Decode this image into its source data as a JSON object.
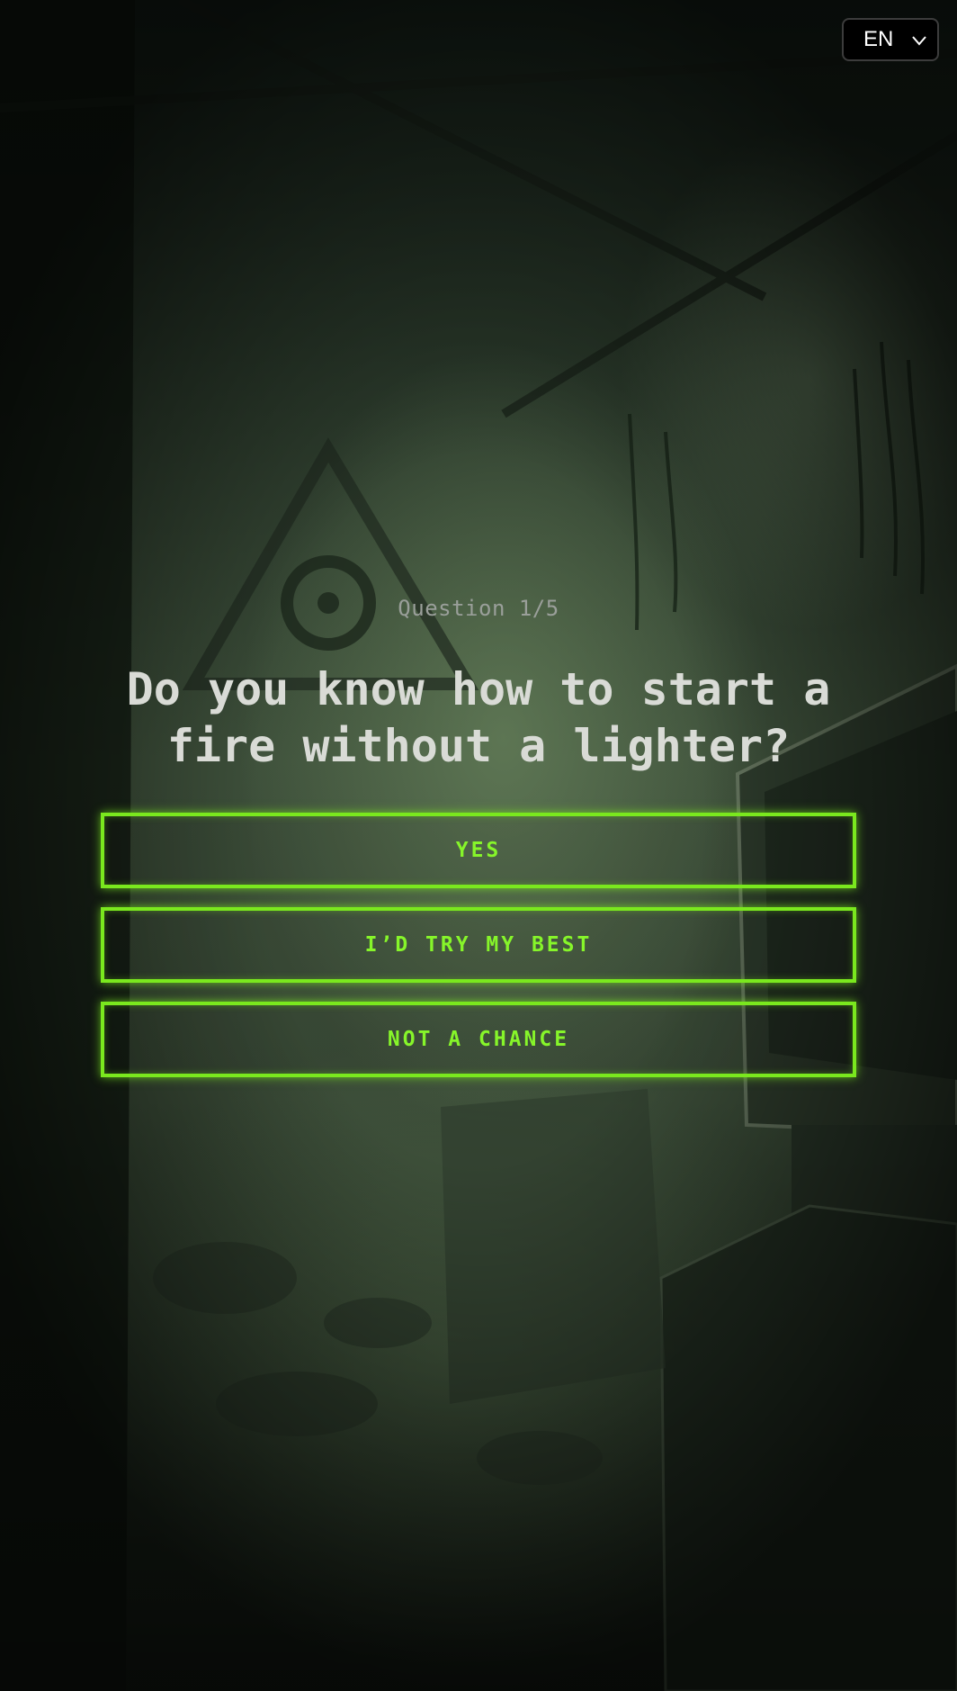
{
  "language": {
    "selected": "EN",
    "icon": "chevron-down-icon"
  },
  "quiz": {
    "counter": "Question 1/5",
    "question": "Do you know how to start a fire without a lighter?",
    "answers": [
      {
        "label": "YES"
      },
      {
        "label": "I’D TRY MY BEST"
      },
      {
        "label": "NOT A CHANCE"
      }
    ]
  },
  "colors": {
    "accent": "#7ae81e",
    "question_text": "#d9dbd6",
    "counter_text": "#9a9f9a"
  }
}
